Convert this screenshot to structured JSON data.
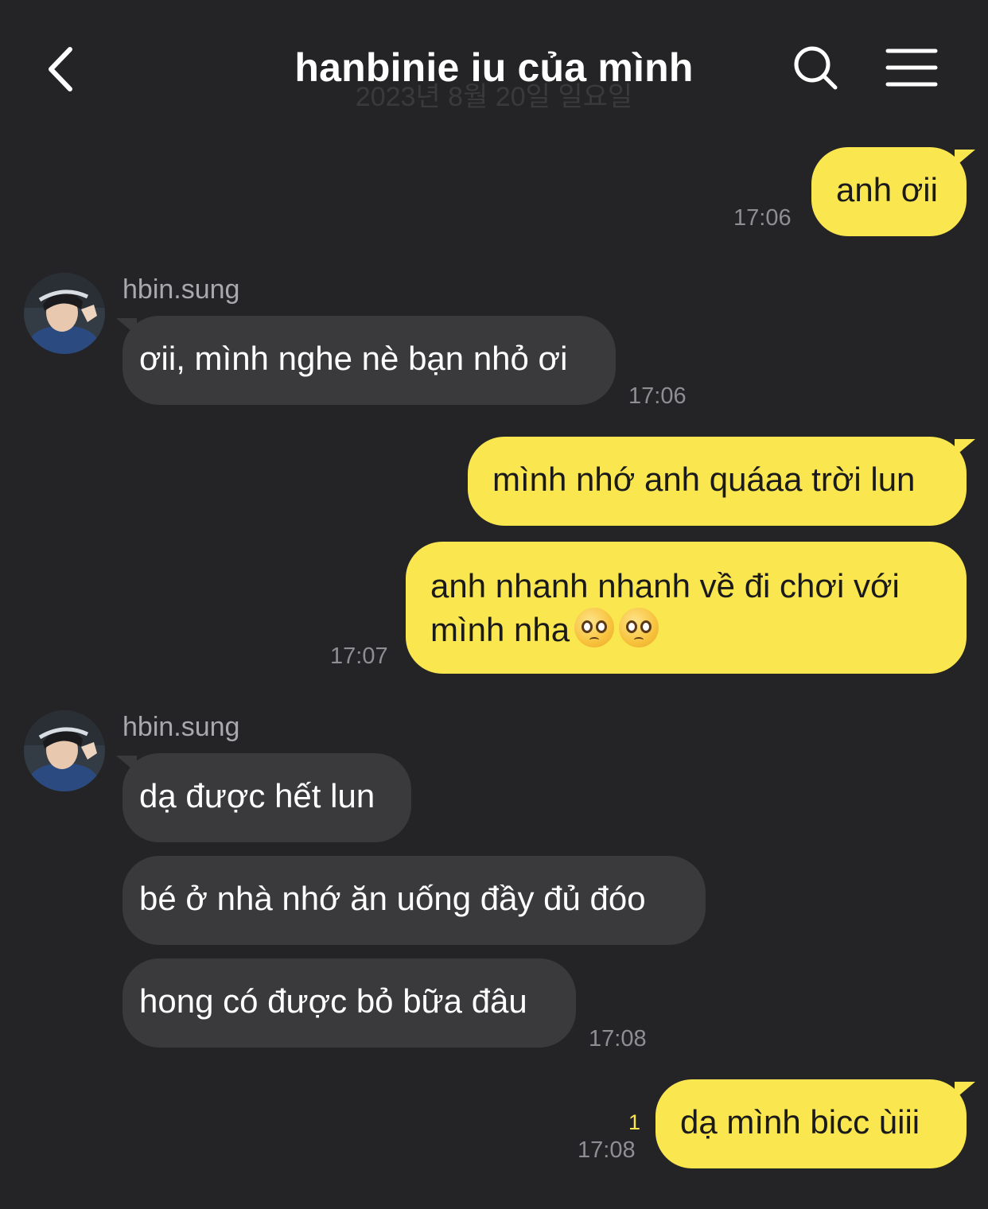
{
  "header": {
    "title": "hanbinie iu của mình",
    "ghost_date": "2023년 8월 20일 일요일"
  },
  "colors": {
    "background": "#242426",
    "outgoing_bubble": "#fae64e",
    "incoming_bubble": "#3a3a3c",
    "unread_count": "#fae64e"
  },
  "icons": [
    "back-icon",
    "search-icon",
    "menu-icon",
    "pleading-face-emoji"
  ],
  "messages": [
    {
      "side": "out",
      "text": "anh ơii",
      "time": "17:06"
    },
    {
      "side": "in",
      "sender": "hbin.sung",
      "text": "ơii, mình nghe nè bạn nhỏ ơi",
      "time": "17:06"
    },
    {
      "side": "out",
      "text": "mình nhớ anh quáaa trời lun"
    },
    {
      "side": "out",
      "text_line1": "anh nhanh nhanh về đi chơi với",
      "text_line2": "mình nha",
      "emoji": "🥺🥺",
      "time": "17:07"
    },
    {
      "side": "in",
      "sender": "hbin.sung",
      "text": "dạ được hết lun"
    },
    {
      "side": "in",
      "text": "bé ở nhà nhớ ăn uống đầy đủ đóo"
    },
    {
      "side": "in",
      "text": "hong có được bỏ bữa đâu",
      "time": "17:08"
    },
    {
      "side": "out",
      "text": "dạ mình bicc ùiii",
      "time": "17:08",
      "unread": "1"
    }
  ]
}
